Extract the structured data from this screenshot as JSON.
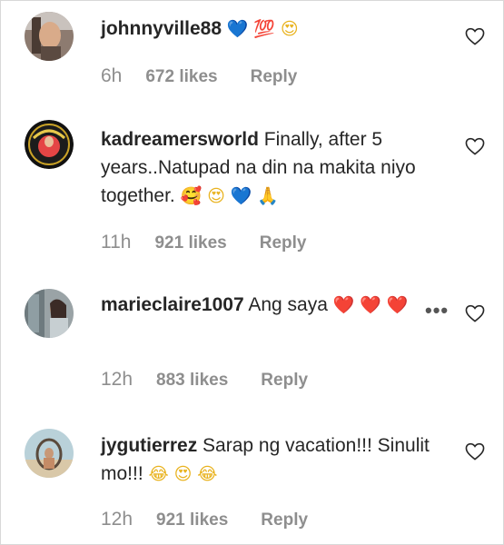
{
  "comments": [
    {
      "username": "johnnyville88",
      "text": "",
      "emojis": [
        "💙",
        "💯",
        "😍"
      ],
      "time": "6h",
      "likes": "672 likes",
      "reply": "Reply"
    },
    {
      "username": "kadreamersworld",
      "text": "Finally, after 5 years..Natupad na din na makita niyo together.",
      "emojis": [
        "🥰",
        "😍",
        "💙",
        "🙏"
      ],
      "time": "11h",
      "likes": "921 likes",
      "reply": "Reply"
    },
    {
      "username": "marieclaire1007",
      "text": "Ang saya",
      "emojis": [
        "❤️",
        "❤️",
        "❤️"
      ],
      "time": "12h",
      "likes": "883 likes",
      "reply": "Reply"
    },
    {
      "username": "jygutierrez",
      "text": "Sarap ng vacation!!! Sinulit mo!!!",
      "emojis": [
        "😂",
        "😍",
        "😂"
      ],
      "time": "12h",
      "likes": "921 likes",
      "reply": "Reply"
    }
  ],
  "icons": {
    "like": "heart-outline-icon",
    "more": "more-options-icon"
  },
  "colors": {
    "text": "#262626",
    "meta": "#8e8e8e",
    "heart_outline": "#262626"
  }
}
